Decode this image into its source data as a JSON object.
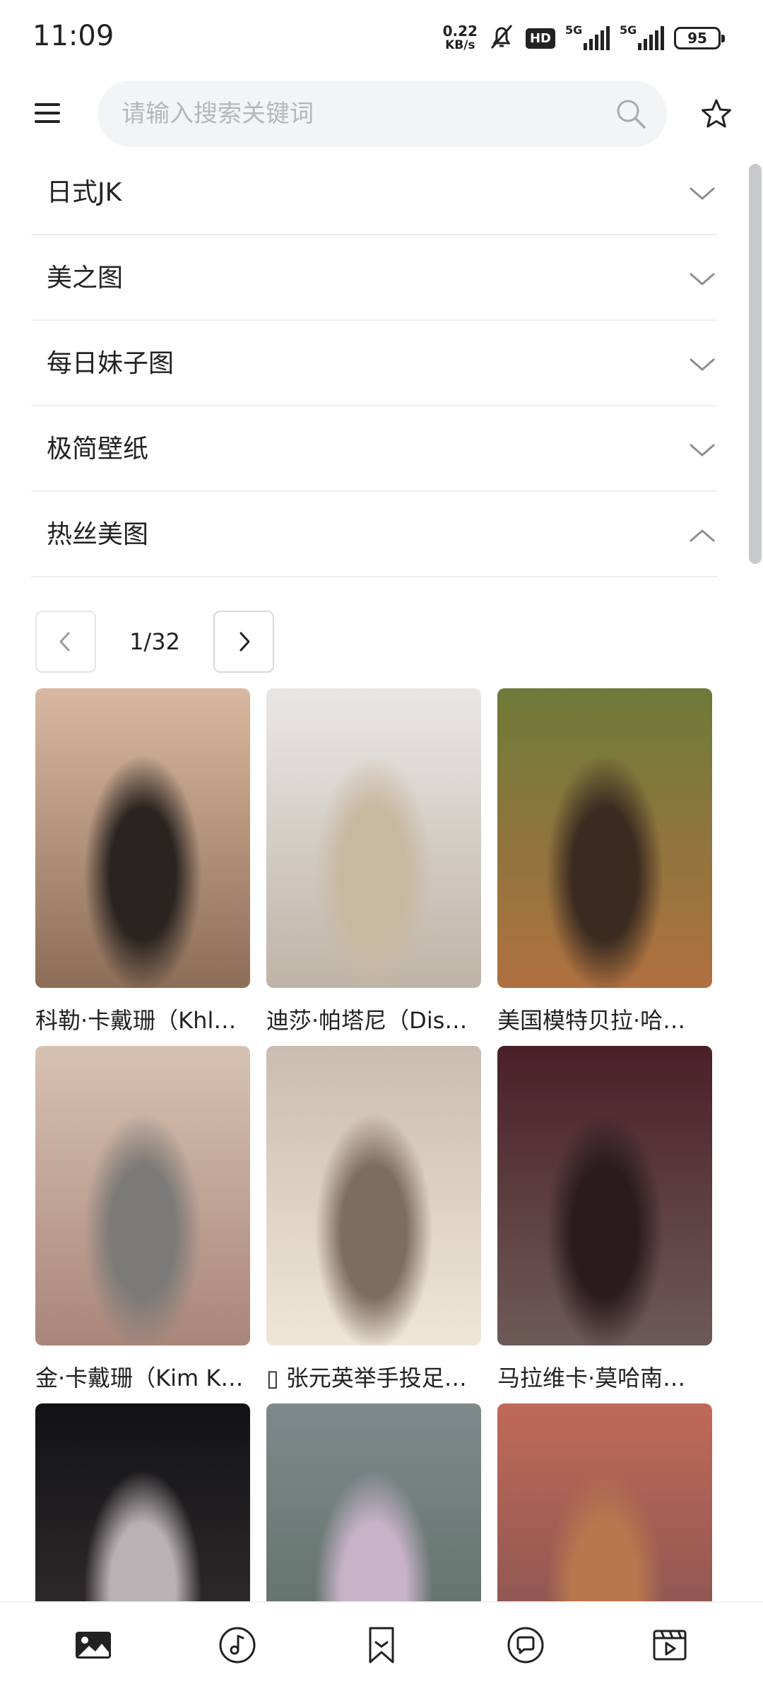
{
  "status_bar": {
    "time": "11:09",
    "net_speed_value": "0.22",
    "net_speed_unit": "KB/s",
    "hd_label": "HD",
    "signal1_label": "5G",
    "signal2_label": "5G",
    "battery": "95"
  },
  "search": {
    "placeholder": "请输入搜索关键词",
    "value": ""
  },
  "categories": [
    {
      "label": "日式JK",
      "expanded": false
    },
    {
      "label": "美之图",
      "expanded": false
    },
    {
      "label": "每日妹子图",
      "expanded": false
    },
    {
      "label": "极简壁纸",
      "expanded": false
    },
    {
      "label": "热丝美图",
      "expanded": true
    }
  ],
  "pagination": {
    "text": "1/32"
  },
  "gallery": [
    {
      "title": "科勒·卡戴珊（Khl…",
      "colors": [
        "#d8b8a0",
        "#8c6e58",
        "#2a2320"
      ]
    },
    {
      "title": "迪莎·帕塔尼（Dis…",
      "colors": [
        "#e9e7e6",
        "#bfb4a6",
        "#c9b8a0"
      ]
    },
    {
      "title": "美国模特贝拉·哈…",
      "colors": [
        "#6e7a3a",
        "#b07040",
        "#3a2a20"
      ]
    },
    {
      "title": "金·卡戴珊（Kim K…",
      "colors": [
        "#d7c2b2",
        "#a9867a",
        "#7c7a78"
      ]
    },
    {
      "title": "▯ 张元英举手投足…",
      "colors": [
        "#cbbcb0",
        "#efe6d8",
        "#7e6c60"
      ]
    },
    {
      "title": "马拉维卡·莫哈南…",
      "colors": [
        "#4a2028",
        "#6e5a58",
        "#2a1c1c"
      ]
    },
    {
      "title": "",
      "colors": [
        "#121214",
        "#3a3436",
        "#b8b2b4"
      ]
    },
    {
      "title": "",
      "colors": [
        "#7e8a8a",
        "#5a6a62",
        "#c8b2c8"
      ]
    },
    {
      "title": "",
      "colors": [
        "#c06a58",
        "#7a4e50",
        "#b8784e"
      ]
    }
  ],
  "bottom_nav": [
    {
      "icon": "image-icon"
    },
    {
      "icon": "music-note-icon"
    },
    {
      "icon": "bookmark-icon"
    },
    {
      "icon": "chat-icon"
    },
    {
      "icon": "video-clip-icon"
    }
  ],
  "theme": {
    "text": "#222222",
    "search_bg": "#f3f4f6",
    "placeholder": "#b5b7bc",
    "divider": "#eeeeee"
  }
}
